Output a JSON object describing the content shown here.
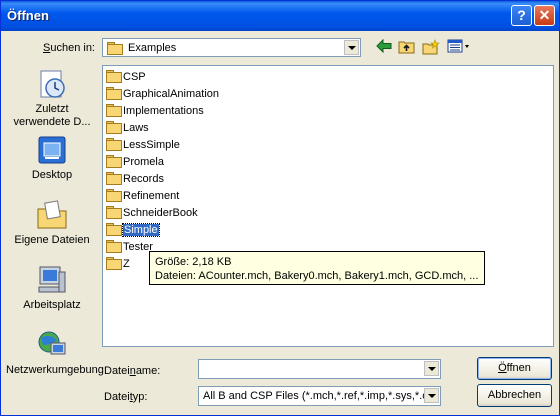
{
  "window": {
    "title": "Öffnen",
    "help_glyph": "?",
    "close_glyph": "✕"
  },
  "lookin": {
    "label_pre": "",
    "label_u": "S",
    "label_post": "uchen in:",
    "value": "Examples"
  },
  "toolbar": {
    "back": "back-arrow-icon",
    "up": "up-folder-icon",
    "new": "new-folder-icon",
    "view": "view-menu-icon",
    "accent": "#0a62d8"
  },
  "places": [
    {
      "label": "Zuletzt verwendete D...",
      "icon": "recent-documents-icon"
    },
    {
      "label": "Desktop",
      "icon": "desktop-icon"
    },
    {
      "label": "Eigene Dateien",
      "icon": "my-documents-icon"
    },
    {
      "label": "Arbeitsplatz",
      "icon": "my-computer-icon"
    },
    {
      "label": "Netzwerkumgebung",
      "icon": "network-icon"
    }
  ],
  "files": [
    "CSP",
    "GraphicalAnimation",
    "Implementations",
    "Laws",
    "LessSimple",
    "Promela",
    "Records",
    "Refinement",
    "SchneiderBook",
    "Simple",
    "Tester",
    "Z"
  ],
  "selected": "Simple",
  "tooltip": {
    "line1": "Größe: 2,18 KB",
    "line2": "Dateien: ACounter.mch, Bakery0.mch, Bakery1.mch, GCD.mch, ..."
  },
  "filename": {
    "label_pre": "Datei",
    "label_u": "n",
    "label_post": "ame:",
    "value": ""
  },
  "filetype": {
    "label_pre": "Datei",
    "label_u": "t",
    "label_post": "yp:",
    "value": "All B and CSP Files (*.mch,*.ref,*.imp,*.sys,*.csp)"
  },
  "buttons": {
    "open_pre": "",
    "open_u": "Ö",
    "open_post": "ffnen",
    "cancel": "Abbrechen"
  }
}
